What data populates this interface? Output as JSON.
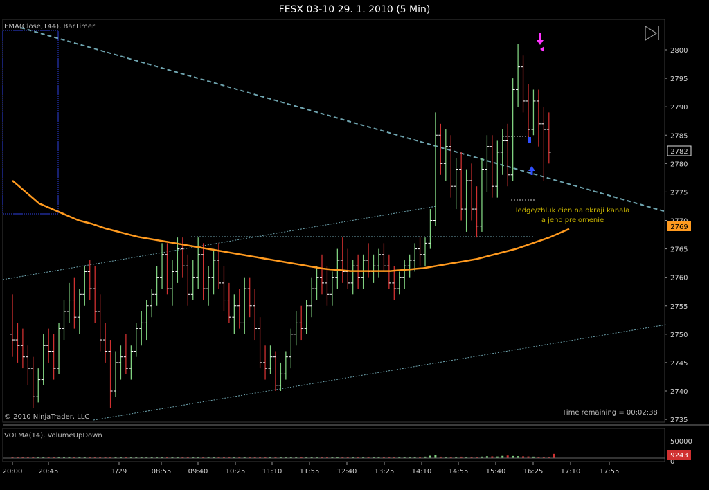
{
  "window": {
    "title": "FESX 03-10  29. 1. 2010 (5 Min)"
  },
  "price_panel": {
    "indicator_label": "EMA(Close,144), BarTimer",
    "copyright": "© 2010 NinjaTrader, LLC",
    "time_remaining": "Time remaining = 00:02:38",
    "last_price_tag": "2782",
    "ema_price_tag": "2769",
    "annotation_line1": "ledge/zhluk cien na okraji kanala",
    "annotation_line2": "a jeho prelomenie",
    "scroll_icon": "scroll-to-end-icon"
  },
  "volume_panel": {
    "indicator_label": "VOLMA(14), VolumeUpDown",
    "last_volume_tag": "9243",
    "y_ticks": [
      "50000",
      "0"
    ]
  },
  "colors": {
    "background": "#000000",
    "up_bar": "#7fd07f",
    "down_bar": "#d03030",
    "ema": "#ff9a1f",
    "trendline": "#6fa5b0",
    "marker": "#ff33ff",
    "dot": "#2f4fff",
    "annotation": "#c8b400"
  },
  "chart_data": {
    "type": "candlestick",
    "title": "FESX 03-10  29. 1. 2010 (5 Min)",
    "ylim": [
      2735,
      2803
    ],
    "y_ticks": [
      2735,
      2740,
      2745,
      2750,
      2755,
      2760,
      2765,
      2770,
      2775,
      2780,
      2785,
      2790,
      2795,
      2800
    ],
    "x_tick_labels": [
      "20:00",
      "20:45",
      "1/29",
      "08:55",
      "09:40",
      "10:25",
      "11:10",
      "11:55",
      "12:40",
      "13:25",
      "14:10",
      "14:55",
      "15:40",
      "16:25",
      "17:10",
      "17:55"
    ],
    "x_tick_bar_index": [
      0,
      9,
      18,
      27,
      36,
      45,
      54,
      63,
      72,
      81,
      90,
      99,
      108,
      117,
      126,
      135
    ],
    "bars_ohlc": [
      [
        2750,
        2757,
        2746,
        2749
      ],
      [
        2749,
        2752,
        2745,
        2748
      ],
      [
        2748,
        2751,
        2744,
        2746
      ],
      [
        2746,
        2748,
        2741,
        2744
      ],
      [
        2744,
        2746,
        2737,
        2739
      ],
      [
        2739,
        2744,
        2738,
        2742
      ],
      [
        2742,
        2750,
        2741,
        2748
      ],
      [
        2748,
        2751,
        2745,
        2747
      ],
      [
        2747,
        2750,
        2742,
        2744
      ],
      [
        2744,
        2752,
        2743,
        2751
      ],
      [
        2751,
        2756,
        2749,
        2754
      ],
      [
        2754,
        2759,
        2752,
        2756
      ],
      [
        2756,
        2760,
        2751,
        2753
      ],
      [
        2753,
        2758,
        2750,
        2757
      ],
      [
        2757,
        2762,
        2755,
        2761
      ],
      [
        2761,
        2763,
        2756,
        2758
      ],
      [
        2758,
        2762,
        2752,
        2754
      ],
      [
        2754,
        2757,
        2747,
        2749
      ],
      [
        2749,
        2752,
        2745,
        2747
      ],
      [
        2747,
        2749,
        2737,
        2740
      ],
      [
        2740,
        2747,
        2739,
        2745
      ],
      [
        2745,
        2748,
        2742,
        2746
      ],
      [
        2746,
        2750,
        2743,
        2744
      ],
      [
        2744,
        2748,
        2742,
        2747
      ],
      [
        2747,
        2752,
        2746,
        2751
      ],
      [
        2751,
        2754,
        2748,
        2752
      ],
      [
        2752,
        2756,
        2749,
        2755
      ],
      [
        2755,
        2758,
        2753,
        2757
      ],
      [
        2757,
        2762,
        2755,
        2760
      ],
      [
        2760,
        2766,
        2758,
        2764
      ],
      [
        2764,
        2766,
        2757,
        2758
      ],
      [
        2758,
        2763,
        2755,
        2761
      ],
      [
        2761,
        2767,
        2759,
        2765
      ],
      [
        2765,
        2767,
        2760,
        2762
      ],
      [
        2762,
        2764,
        2755,
        2757
      ],
      [
        2757,
        2763,
        2756,
        2760
      ],
      [
        2760,
        2767,
        2758,
        2764
      ],
      [
        2764,
        2766,
        2756,
        2758
      ],
      [
        2758,
        2762,
        2755,
        2760
      ],
      [
        2760,
        2765,
        2757,
        2763
      ],
      [
        2763,
        2766,
        2758,
        2759
      ],
      [
        2759,
        2762,
        2754,
        2756
      ],
      [
        2756,
        2759,
        2752,
        2753
      ],
      [
        2753,
        2757,
        2750,
        2755
      ],
      [
        2755,
        2758,
        2751,
        2752
      ],
      [
        2752,
        2760,
        2750,
        2758
      ],
      [
        2758,
        2760,
        2753,
        2755
      ],
      [
        2755,
        2758,
        2749,
        2751
      ],
      [
        2751,
        2753,
        2744,
        2745
      ],
      [
        2745,
        2748,
        2742,
        2744
      ],
      [
        2744,
        2748,
        2743,
        2746
      ],
      [
        2746,
        2747,
        2740,
        2741
      ],
      [
        2741,
        2745,
        2740,
        2743
      ],
      [
        2743,
        2747,
        2742,
        2746
      ],
      [
        2746,
        2751,
        2744,
        2750
      ],
      [
        2750,
        2754,
        2748,
        2752
      ],
      [
        2752,
        2755,
        2749,
        2751
      ],
      [
        2751,
        2756,
        2750,
        2755
      ],
      [
        2755,
        2760,
        2753,
        2758
      ],
      [
        2758,
        2762,
        2756,
        2760
      ],
      [
        2760,
        2764,
        2757,
        2759
      ],
      [
        2759,
        2762,
        2755,
        2757
      ],
      [
        2757,
        2761,
        2755,
        2760
      ],
      [
        2760,
        2765,
        2758,
        2763
      ],
      [
        2763,
        2767,
        2759,
        2761
      ],
      [
        2761,
        2765,
        2758,
        2759
      ],
      [
        2759,
        2763,
        2757,
        2762
      ],
      [
        2762,
        2764,
        2758,
        2760
      ],
      [
        2760,
        2764,
        2758,
        2763
      ],
      [
        2763,
        2766,
        2760,
        2761
      ],
      [
        2761,
        2764,
        2759,
        2762
      ],
      [
        2762,
        2765,
        2760,
        2764
      ],
      [
        2764,
        2766,
        2761,
        2762
      ],
      [
        2762,
        2764,
        2758,
        2759
      ],
      [
        2759,
        2762,
        2756,
        2758
      ],
      [
        2758,
        2761,
        2757,
        2760
      ],
      [
        2760,
        2763,
        2758,
        2762
      ],
      [
        2762,
        2764,
        2760,
        2763
      ],
      [
        2763,
        2766,
        2761,
        2765
      ],
      [
        2765,
        2767,
        2762,
        2764
      ],
      [
        2764,
        2767,
        2762,
        2766
      ],
      [
        2766,
        2772,
        2765,
        2770
      ],
      [
        2770,
        2789,
        2769,
        2785
      ],
      [
        2785,
        2787,
        2778,
        2780
      ],
      [
        2780,
        2786,
        2777,
        2783
      ],
      [
        2783,
        2785,
        2774,
        2776
      ],
      [
        2776,
        2781,
        2772,
        2779
      ],
      [
        2779,
        2782,
        2770,
        2772
      ],
      [
        2772,
        2779,
        2768,
        2777
      ],
      [
        2777,
        2780,
        2770,
        2772
      ],
      [
        2772,
        2776,
        2767,
        2769
      ],
      [
        2769,
        2781,
        2768,
        2779
      ],
      [
        2779,
        2785,
        2775,
        2783
      ],
      [
        2783,
        2785,
        2774,
        2776
      ],
      [
        2776,
        2784,
        2774,
        2782
      ],
      [
        2782,
        2786,
        2778,
        2784
      ],
      [
        2784,
        2787,
        2776,
        2778
      ],
      [
        2778,
        2795,
        2777,
        2793
      ],
      [
        2793,
        2801,
        2790,
        2797
      ],
      [
        2797,
        2799,
        2789,
        2791
      ],
      [
        2791,
        2794,
        2784,
        2786
      ],
      [
        2786,
        2793,
        2785,
        2791
      ],
      [
        2791,
        2793,
        2783,
        2787
      ],
      [
        2787,
        2790,
        2777,
        2786
      ],
      [
        2786,
        2789,
        2780,
        2782
      ]
    ],
    "ema_144": [
      2777,
      2776,
      2775,
      2774,
      2773,
      2772.5,
      2772,
      2771.5,
      2771,
      2770.5,
      2770,
      2769.7,
      2769.4,
      2769,
      2768.6,
      2768.3,
      2768,
      2767.7,
      2767.4,
      2767.1,
      2766.9,
      2766.7,
      2766.5,
      2766.3,
      2766.1,
      2765.9,
      2765.7,
      2765.5,
      2765.3,
      2765.1,
      2764.9,
      2764.7,
      2764.5,
      2764.3,
      2764.1,
      2763.9,
      2763.7,
      2763.5,
      2763.3,
      2763.1,
      2762.9,
      2762.7,
      2762.5,
      2762.3,
      2762.1,
      2761.9,
      2761.7,
      2761.5,
      2761.4,
      2761.3,
      2761.2,
      2761.1,
      2761.1,
      2761.1,
      2761.1,
      2761.1,
      2761.1,
      2761.1,
      2761.2,
      2761.3,
      2761.4,
      2761.5,
      2761.6,
      2761.8,
      2762,
      2762.2,
      2762.4,
      2762.6,
      2762.8,
      2763,
      2763.2,
      2763.5,
      2763.8,
      2764.1,
      2764.4,
      2764.7,
      2765,
      2765.4,
      2765.8,
      2766.2,
      2766.6,
      2767,
      2767.5,
      2768,
      2768.5
    ],
    "volume": [
      1800,
      1500,
      1600,
      1400,
      2100,
      1700,
      1300,
      1500,
      1200,
      1600,
      1400,
      1300,
      1700,
      1500,
      1400,
      1300,
      1200,
      1500,
      1400,
      1100,
      1300,
      1400,
      1200,
      1600,
      1500,
      1300,
      1800,
      1400,
      1600,
      1500,
      1300,
      1700,
      1500,
      1400,
      1300,
      1600,
      1500,
      1700,
      1800,
      1600,
      1400,
      1500,
      1300,
      1400,
      1600,
      1500,
      1300,
      1400,
      1500,
      1200,
      1300,
      1400,
      1500,
      1600,
      1700,
      1500,
      1400,
      1600,
      1500,
      1700,
      1800,
      1900,
      1600,
      1500,
      1700,
      1600,
      1400,
      1500,
      1600,
      1700,
      1500,
      1400,
      1600,
      1700,
      2000,
      2300,
      2100,
      2400,
      2600,
      2800,
      3200,
      5200,
      6200,
      3100,
      2600,
      2200,
      2900,
      3100,
      2500,
      2700,
      2400,
      3300,
      4100,
      3800,
      3500,
      4900,
      5600,
      4700,
      4300,
      3900,
      3600,
      3200,
      3000,
      2800,
      2600,
      9243
    ],
    "volume_ylim": [
      0,
      60000
    ]
  }
}
